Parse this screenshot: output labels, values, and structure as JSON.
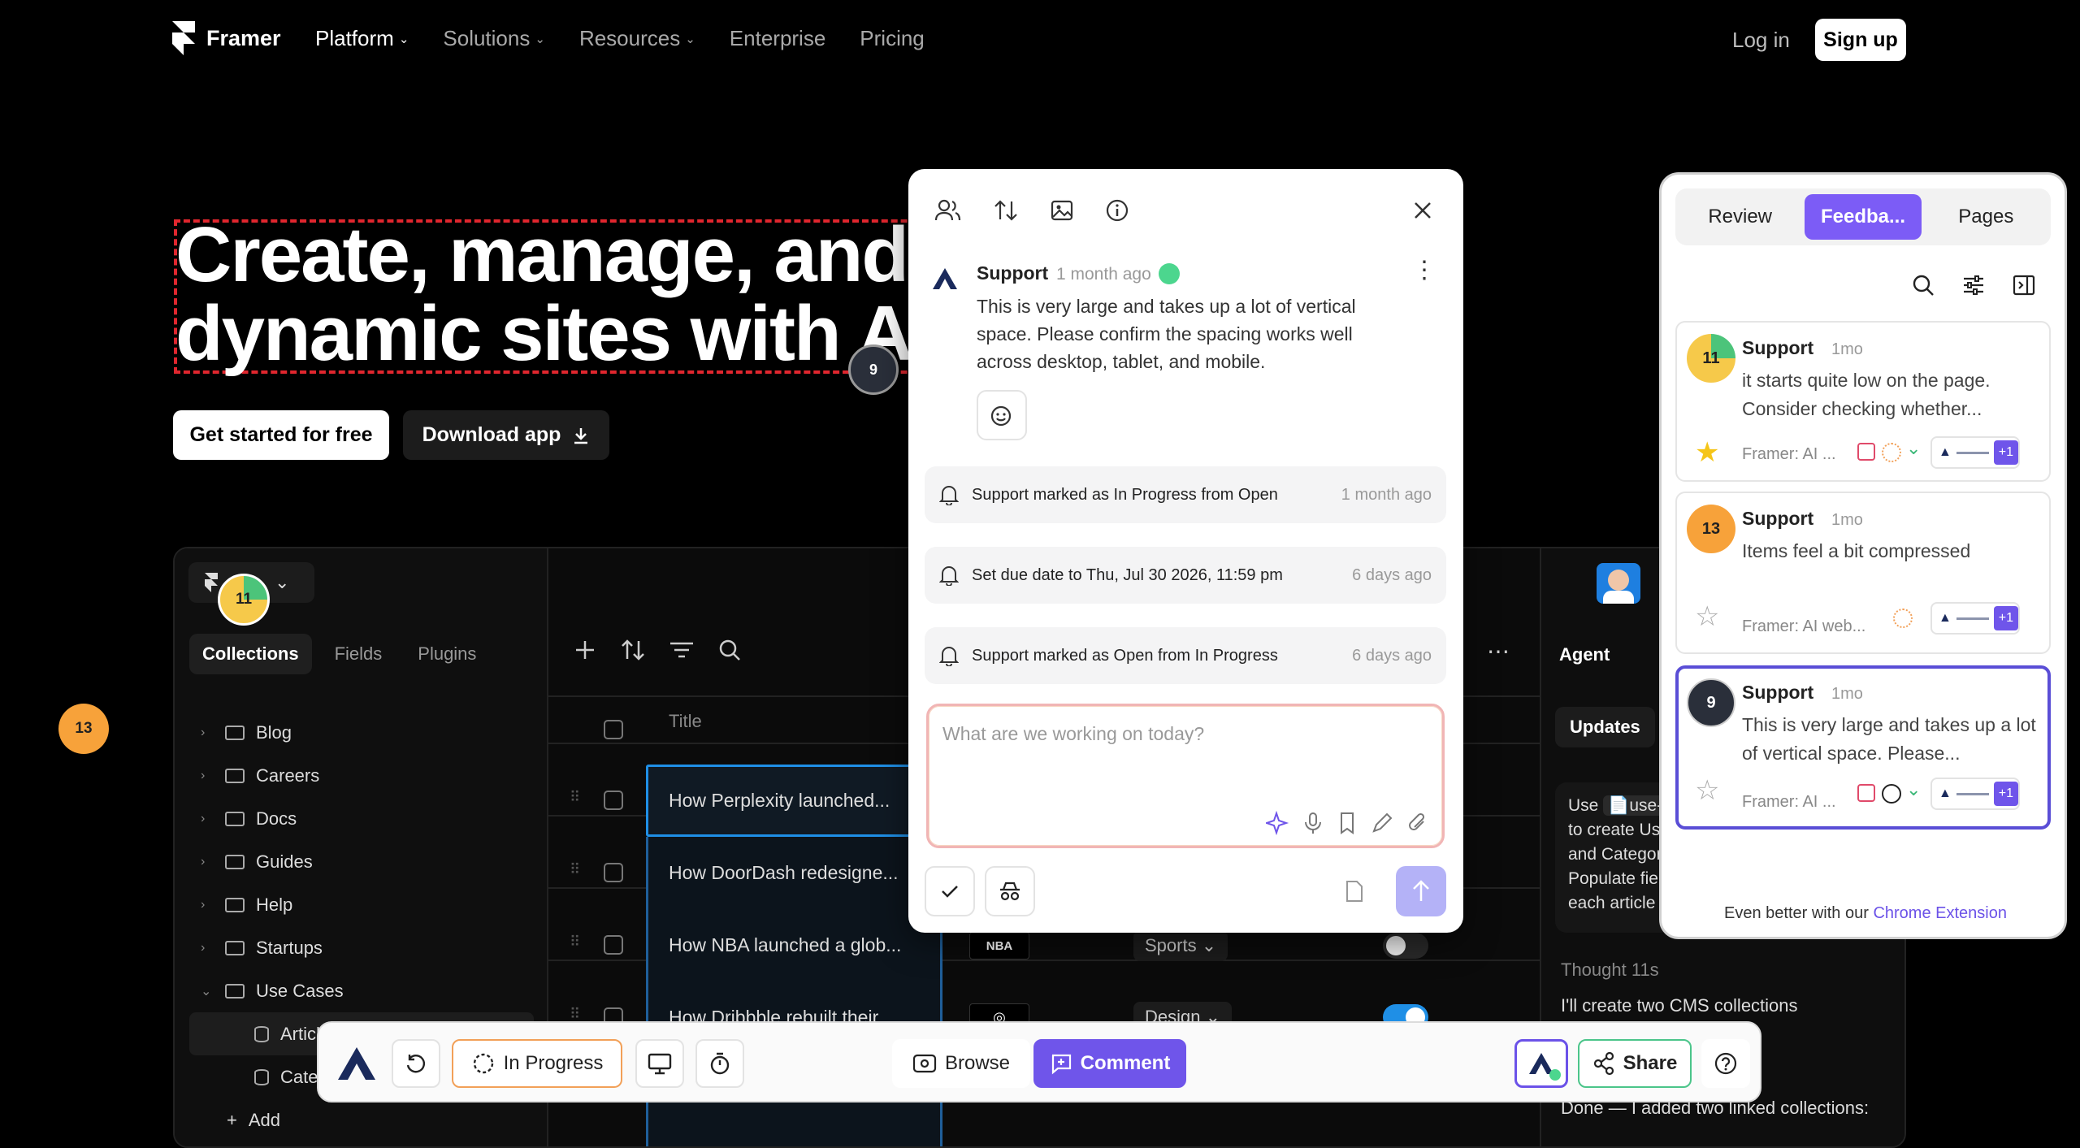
{
  "nav": {
    "brand": "Framer",
    "links": [
      {
        "label": "Platform",
        "dropdown": true,
        "active": true
      },
      {
        "label": "Solutions",
        "dropdown": true
      },
      {
        "label": "Resources",
        "dropdown": true
      },
      {
        "label": "Enterprise",
        "dropdown": false
      },
      {
        "label": "Pricing",
        "dropdown": false
      }
    ],
    "login": "Log in",
    "signup": "Sign up"
  },
  "hero": {
    "line1": "Create, manage, and publish",
    "line2": "dynamic sites with AI agents",
    "cta_primary": "Get started for free",
    "cta_secondary": "Download app"
  },
  "app": {
    "tabs": [
      "Collections",
      "Fields",
      "Plugins"
    ],
    "tree": [
      {
        "label": "Blog"
      },
      {
        "label": "Careers"
      },
      {
        "label": "Docs"
      },
      {
        "label": "Guides"
      },
      {
        "label": "Help"
      },
      {
        "label": "Startups"
      },
      {
        "label": "Use Cases",
        "open": true
      }
    ],
    "subitems": [
      "Articles",
      "Categories"
    ],
    "add_label": "Add",
    "table_header": "Title",
    "rows": [
      {
        "title": "How Perplexity launched..."
      },
      {
        "title": "How DoorDash redesigne..."
      },
      {
        "title": "How NBA launched a glob...",
        "tag": "Sports",
        "logo": "NBA"
      },
      {
        "title": "How Dribbble rebuilt their...",
        "tag": "Design"
      }
    ],
    "agent": {
      "title": "Agent",
      "updates": "Updates",
      "msg": [
        "Use",
        "use-",
        "to create Us",
        "and Categor",
        "Populate fie",
        "each article"
      ],
      "thought": "Thought 11s",
      "reply": "I'll create two CMS collections",
      "done": "Done — I added two linked collections:"
    }
  },
  "comment_panel": {
    "author": "Support",
    "time": "1 month ago",
    "text": "This is very large and takes up a lot of vertical space. Please confirm the spacing works well across desktop, tablet, and mobile.",
    "activity": [
      {
        "text": "Support marked as In Progress from Open",
        "time": "1 month ago"
      },
      {
        "text": "Set due date to Thu, Jul 30 2026, 11:59 pm",
        "time": "6 days ago"
      },
      {
        "text": "Support marked as Open from In Progress",
        "time": "6 days ago"
      }
    ],
    "placeholder": "What are we working on today?"
  },
  "feedback_panel": {
    "tabs": [
      "Review",
      "Feedba...",
      "Pages"
    ],
    "cards": [
      {
        "badge": "11",
        "author": "Support",
        "time": "1mo",
        "text": "it starts quite low on the page. Consider checking whether...",
        "source": "Framer: AI ...",
        "extra": "+1",
        "starred": true,
        "badge_color": "#f6c94a"
      },
      {
        "badge": "13",
        "author": "Support",
        "time": "1mo",
        "text": "Items feel a bit compressed",
        "source": "Framer: AI web...",
        "extra": "+1",
        "starred": false,
        "badge_color": "#f7a23a"
      },
      {
        "badge": "9",
        "author": "Support",
        "time": "1mo",
        "text": "This is very large and takes up a lot of vertical space. Please...",
        "source": "Framer: AI ...",
        "extra": "+1",
        "starred": false,
        "badge_color": "#2a2f3a"
      }
    ],
    "footer_text": "Even better with our",
    "footer_link": "Chrome Extension"
  },
  "toolbar": {
    "status": "In Progress",
    "browse": "Browse",
    "comment": "Comment",
    "share": "Share"
  },
  "markers": {
    "hero": "9",
    "app": "11",
    "left": "13"
  },
  "colors": {
    "accent": "#6f55ea",
    "selection": "#1f8fe6",
    "hero_outline": "#e0262e"
  }
}
